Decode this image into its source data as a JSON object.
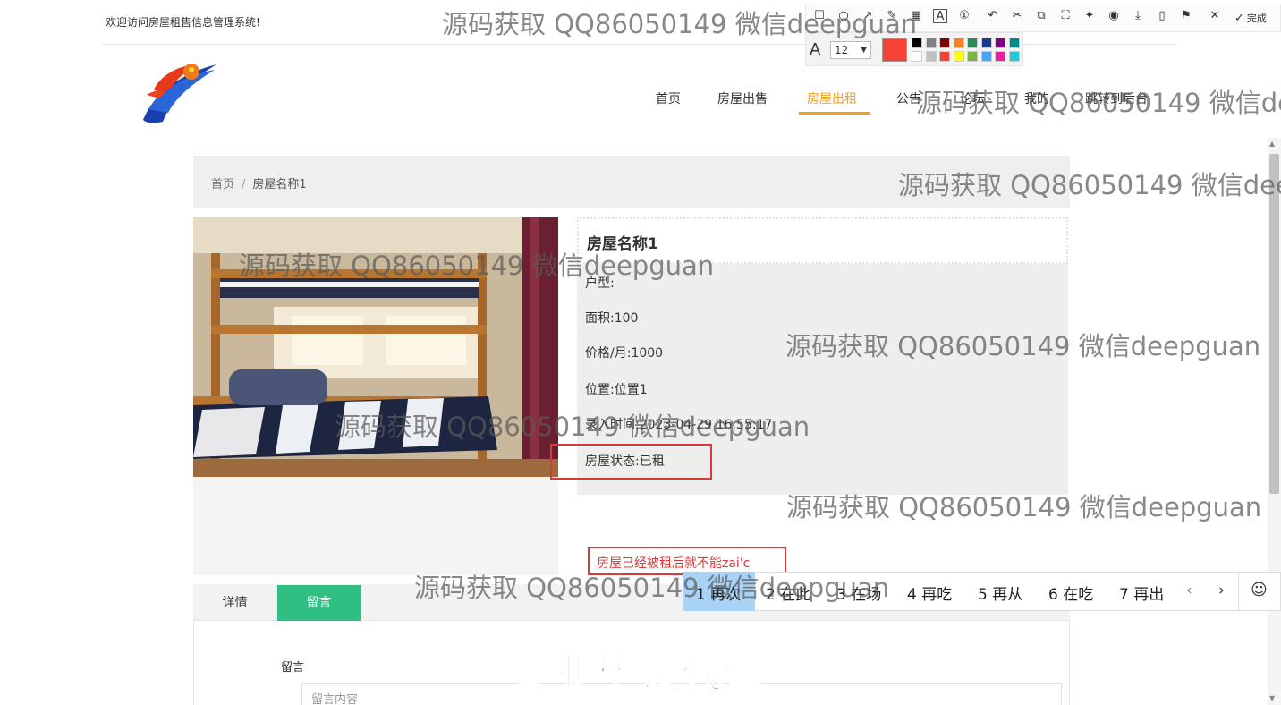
{
  "header": {
    "welcome": "欢迎访问房屋租售信息管理系统!"
  },
  "nav": {
    "items": [
      {
        "label": "首页",
        "active": false
      },
      {
        "label": "房屋出售",
        "active": false
      },
      {
        "label": "房屋出租",
        "active": true
      },
      {
        "label": "公告",
        "active": false
      },
      {
        "label": "论坛",
        "active": false
      },
      {
        "label": "我的",
        "active": false
      },
      {
        "label": "跳转到后台",
        "active": false
      }
    ],
    "active_color": "#f0a21b"
  },
  "breadcrumb": {
    "home": "首页",
    "separator": "/",
    "current": "房屋名称1"
  },
  "house": {
    "title": "房屋名称1",
    "type_label": "户型:",
    "type_value": "",
    "area_label": "面积:",
    "area_value": "100",
    "price_label": "价格/月:",
    "price_value": "1000",
    "location_label": "位置:",
    "location_value": "位置1",
    "time_label": "录入时间:",
    "time_value": "2023-04-29 16:55:17",
    "status_label": "房屋状态:",
    "status_value": "已租"
  },
  "annotation": {
    "text": "房屋已经被租后就不能zai'c"
  },
  "tabs": {
    "details": "详情",
    "message": "留言"
  },
  "message_form": {
    "label": "留言",
    "placeholder": "留言内容",
    "accent": "#2fbf82"
  },
  "screenshot_tool": {
    "done_label": "完成",
    "font_size": "12",
    "current_color": "#f44336",
    "icons": [
      "rectangle-icon",
      "ellipse-icon",
      "arrow-icon",
      "pen-icon",
      "mosaic-icon",
      "text-icon",
      "number-icon",
      "undo-icon",
      "cut-icon",
      "translate-icon",
      "ocr-icon",
      "pin-icon",
      "record-icon",
      "download-icon",
      "phone-icon",
      "bookmark-icon",
      "close-icon"
    ],
    "palette": [
      "#000000",
      "#808080",
      "#800000",
      "#f58220",
      "#2e8b57",
      "#1e3a8a",
      "#800080",
      "#008b8b",
      "#ffffff",
      "#c0c0c0",
      "#f44336",
      "#ffff00",
      "#7cb342",
      "#42a5f5",
      "#e91e9e",
      "#26c6da"
    ]
  },
  "ime": {
    "candidates": [
      {
        "index": "1",
        "text": "再次"
      },
      {
        "index": "2",
        "text": "在此"
      },
      {
        "index": "3",
        "text": "在场"
      },
      {
        "index": "4",
        "text": "再吃"
      },
      {
        "index": "5",
        "text": "再从"
      },
      {
        "index": "6",
        "text": "在吃"
      },
      {
        "index": "7",
        "text": "再出"
      }
    ]
  },
  "watermarks": {
    "line": "源码获取 QQ86050149 微信deepguan",
    "banner": "专业毕设代做"
  }
}
